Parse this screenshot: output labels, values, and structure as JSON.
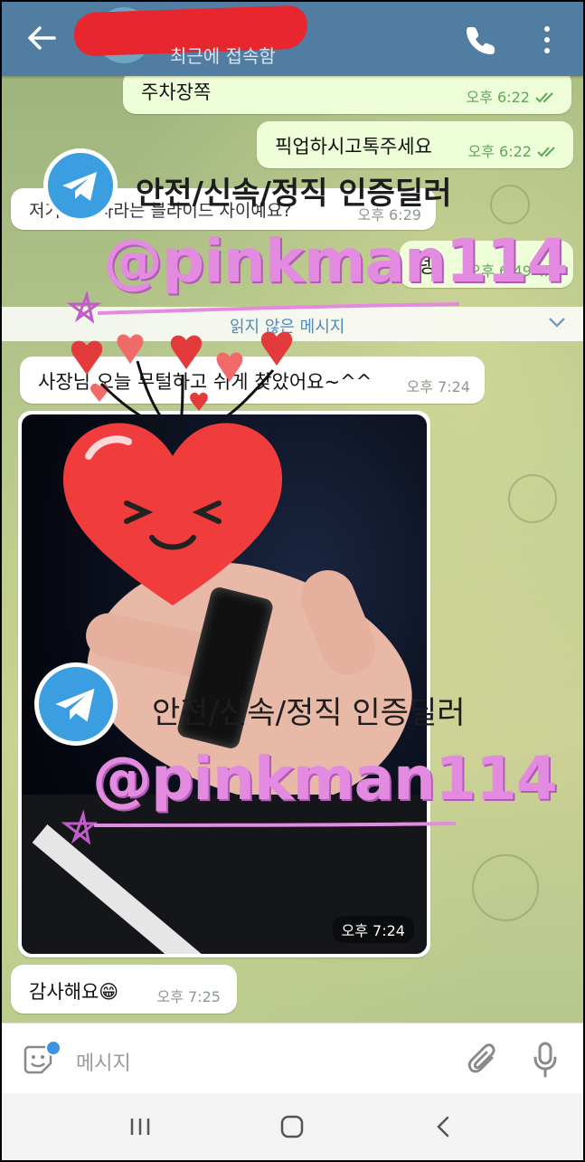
{
  "header": {
    "status": "최근에 접속함",
    "colors": {
      "bar": "#517da2",
      "redaction": "#e8262e"
    }
  },
  "messages": [
    {
      "text": "주차장쪽",
      "time": "오후 6:22",
      "direction": "out",
      "read": true
    },
    {
      "text": "픽업하시고톡주세요",
      "time": "오후 6:22",
      "direction": "out",
      "read": true
    },
    {
      "text": "저기 고급차라는 블라이드 자이예요?",
      "time": "오후 6:29",
      "direction": "in"
    },
    {
      "text": "넹",
      "time": "오후 6:49",
      "direction": "out",
      "read": true
    },
    {
      "text": "사장님 오늘 무털하고 쉬게 찾았어요~^^",
      "time": "오후 7:24",
      "direction": "in"
    },
    {
      "time": "오후 7:24",
      "direction": "in",
      "type": "photo"
    },
    {
      "text": "감사해요",
      "emoji": "😁",
      "time": "오후 7:25",
      "direction": "in"
    }
  ],
  "unread_divider": "읽지 않은 메시지",
  "watermark": {
    "title": "안전/신속/정직 인증딜러",
    "handle": "@pinkman114"
  },
  "input": {
    "placeholder": "메시지"
  },
  "icons": {
    "back": "arrow-left-icon",
    "call": "phone-icon",
    "menu": "more-vert-icon",
    "emoji": "sticker-icon",
    "attach": "paperclip-icon",
    "mic": "microphone-icon",
    "telegram": "telegram-logo-icon"
  }
}
